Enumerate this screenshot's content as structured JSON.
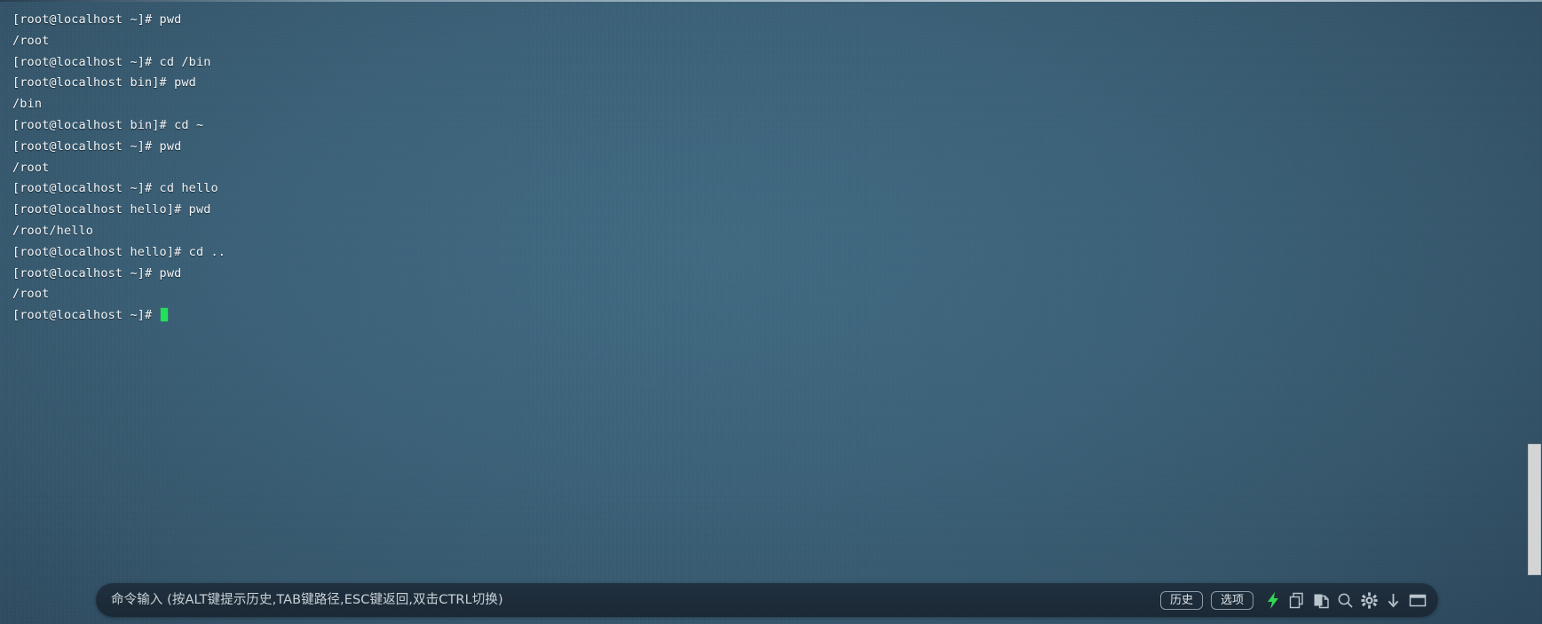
{
  "terminal": {
    "lines": [
      {
        "text": "[root@localhost ~]# pwd"
      },
      {
        "text": "/root"
      },
      {
        "text": "[root@localhost ~]# cd /bin"
      },
      {
        "text": "[root@localhost bin]# pwd"
      },
      {
        "text": "/bin"
      },
      {
        "text": "[root@localhost bin]# cd ~"
      },
      {
        "text": "[root@localhost ~]# pwd"
      },
      {
        "text": "/root"
      },
      {
        "text": "[root@localhost ~]# cd hello"
      },
      {
        "text": "[root@localhost hello]# pwd"
      },
      {
        "text": "/root/hello"
      },
      {
        "text": "[root@localhost hello]# cd .."
      },
      {
        "text": "[root@localhost ~]# pwd"
      },
      {
        "text": "/root"
      }
    ],
    "prompt": "[root@localhost ~]# ",
    "cursor_color": "#23e05a",
    "text_color": "#f2f5f7"
  },
  "command_bar": {
    "input_value": "",
    "placeholder": "命令输入 (按ALT键提示历史,TAB键路径,ESC键返回,双击CTRL切换)",
    "buttons": [
      {
        "label": "历史",
        "name": "history-button"
      },
      {
        "label": "选项",
        "name": "options-button"
      }
    ],
    "icons": [
      {
        "name": "lightning-icon",
        "color": "#2fd851"
      },
      {
        "name": "copy-icon",
        "color": "#b9c4cc"
      },
      {
        "name": "paste-icon",
        "color": "#b9c4cc"
      },
      {
        "name": "search-icon",
        "color": "#b9c4cc"
      },
      {
        "name": "gear-icon",
        "color": "#b9c4cc"
      },
      {
        "name": "download-arrow-icon",
        "color": "#b9c4cc"
      },
      {
        "name": "window-icon",
        "color": "#b9c4cc"
      }
    ]
  },
  "scrollbar": {
    "thumb_color": "#d2d4d6"
  },
  "theme": {
    "background_center": "#406a82",
    "background_edge": "#25384d",
    "bar_background": "#1b2835"
  }
}
